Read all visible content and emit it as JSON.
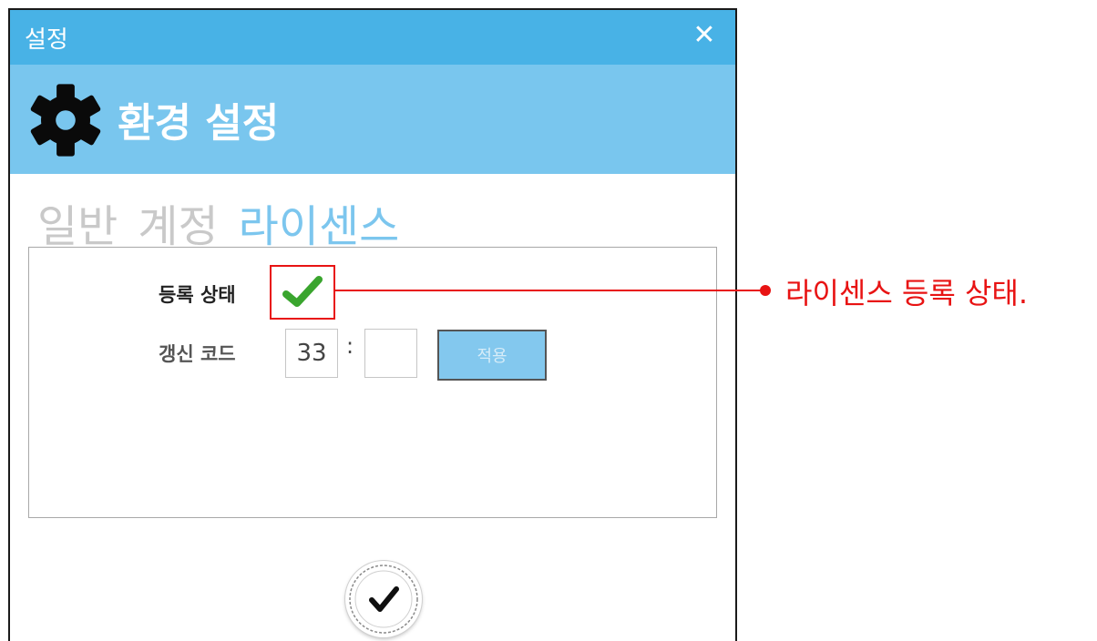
{
  "window": {
    "title": "설정"
  },
  "header": {
    "title": "환경 설정"
  },
  "tabs": [
    {
      "label": "일반",
      "active": false
    },
    {
      "label": "계정",
      "active": false
    },
    {
      "label": "라이센스",
      "active": true
    }
  ],
  "license": {
    "status_label": "등록 상태",
    "status_registered": true,
    "code_label": "갱신 코드",
    "code_part1": "33",
    "code_separator": ":",
    "code_part2": "",
    "apply_label": "적용"
  },
  "callout": {
    "text": "라이센스 등록 상태."
  },
  "icons": {
    "close": "close-icon",
    "gear": "gear-icon",
    "status": "check-icon",
    "confirm": "check-circle-icon"
  },
  "colors": {
    "titlebar": "#48b2e6",
    "header": "#79c6ee",
    "active_tab": "#7cc6ee",
    "inactive_tab": "#c9c9c9",
    "callout": "#e81313",
    "check_green": "#3aa52e"
  }
}
